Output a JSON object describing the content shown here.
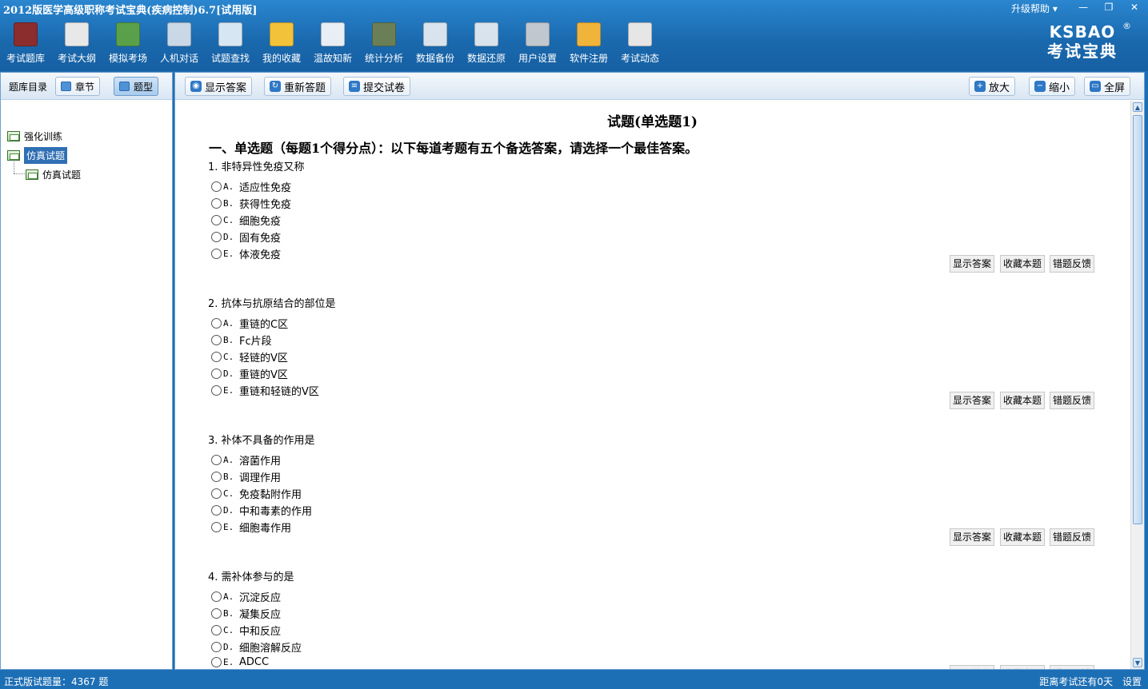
{
  "window": {
    "title": "2012版医学高级职称考试宝典(疾病控制)6.7[试用版]",
    "upgrade_help": "升级帮助 ▾",
    "controls": [
      "—",
      "❐",
      "✕"
    ]
  },
  "toolbar": [
    {
      "label": "考试题库",
      "icon": "book-icon",
      "color": "#8b2d2d"
    },
    {
      "label": "考试大纲",
      "icon": "document-icon",
      "color": "#e8e8e8"
    },
    {
      "label": "模拟考场",
      "icon": "pencil-icon",
      "color": "#5aa04a"
    },
    {
      "label": "人机对话",
      "icon": "person-dialog-icon",
      "color": "#c9d8e6"
    },
    {
      "label": "试题查找",
      "icon": "magnifier-icon",
      "color": "#d7e6f3"
    },
    {
      "label": "我的收藏",
      "icon": "star-icon",
      "color": "#f2c23a"
    },
    {
      "label": "温故知新",
      "icon": "lightbulb-icon",
      "color": "#e9eef4"
    },
    {
      "label": "统计分析",
      "icon": "chart-icon",
      "color": "#6a7f57"
    },
    {
      "label": "数据备份",
      "icon": "backup-icon",
      "color": "#d9e3ed"
    },
    {
      "label": "数据还原",
      "icon": "restore-icon",
      "color": "#d9e3ed"
    },
    {
      "label": "用户设置",
      "icon": "hammer-icon",
      "color": "#c0c7cf"
    },
    {
      "label": "软件注册",
      "icon": "lock-icon",
      "color": "#f0b43a"
    },
    {
      "label": "考试动态",
      "icon": "news-icon",
      "color": "#e6e6e6"
    }
  ],
  "brand": {
    "line1": "KSBAO",
    "line2": "考试宝典",
    "reg": "®"
  },
  "left": {
    "header_label": "题库目录",
    "tab_chapter": "章节",
    "tab_type": "题型",
    "tree": [
      "强化训练",
      "仿真试题",
      "仿真试题"
    ]
  },
  "right": {
    "btn_show_answer": "显示答案",
    "btn_restart": "重新答题",
    "btn_submit": "提交试卷",
    "btn_zoom_in": "放大",
    "btn_zoom_out": "缩小",
    "btn_fullscreen": "全屏"
  },
  "paper": {
    "title": "试题(单选题1)",
    "section": "一、单选题（每题1个得分点）：以下每道考题有五个备选答案，请选择一个最佳答案。",
    "q_buttons": [
      "显示答案",
      "收藏本题",
      "错题反馈"
    ],
    "questions": [
      {
        "stem": "1. 非特异性免疫又称",
        "options": [
          [
            "A.",
            "适应性免疫"
          ],
          [
            "B.",
            "获得性免疫"
          ],
          [
            "C.",
            "细胞免疫"
          ],
          [
            "D.",
            "固有免疫"
          ],
          [
            "E.",
            "体液免疫"
          ]
        ]
      },
      {
        "stem": "2. 抗体与抗原结合的部位是",
        "options": [
          [
            "A.",
            "重链的C区"
          ],
          [
            "B.",
            "Fc片段"
          ],
          [
            "C.",
            "轻链的V区"
          ],
          [
            "D.",
            "重链的V区"
          ],
          [
            "E.",
            "重链和轻链的V区"
          ]
        ]
      },
      {
        "stem": "3. 补体不具备的作用是",
        "options": [
          [
            "A.",
            "溶菌作用"
          ],
          [
            "B.",
            "调理作用"
          ],
          [
            "C.",
            "免疫黏附作用"
          ],
          [
            "D.",
            "中和毒素的作用"
          ],
          [
            "E.",
            "细胞毒作用"
          ]
        ]
      },
      {
        "stem": "4. 需补体参与的是",
        "options": [
          [
            "A.",
            "沉淀反应"
          ],
          [
            "B.",
            "凝集反应"
          ],
          [
            "C.",
            "中和反应"
          ],
          [
            "D.",
            "细胞溶解反应"
          ],
          [
            "E.",
            "ADCC"
          ]
        ]
      }
    ]
  },
  "status": {
    "left": "正式版试题量：4367 题",
    "countdown": "距离考试还有0天",
    "settings": "设置"
  }
}
